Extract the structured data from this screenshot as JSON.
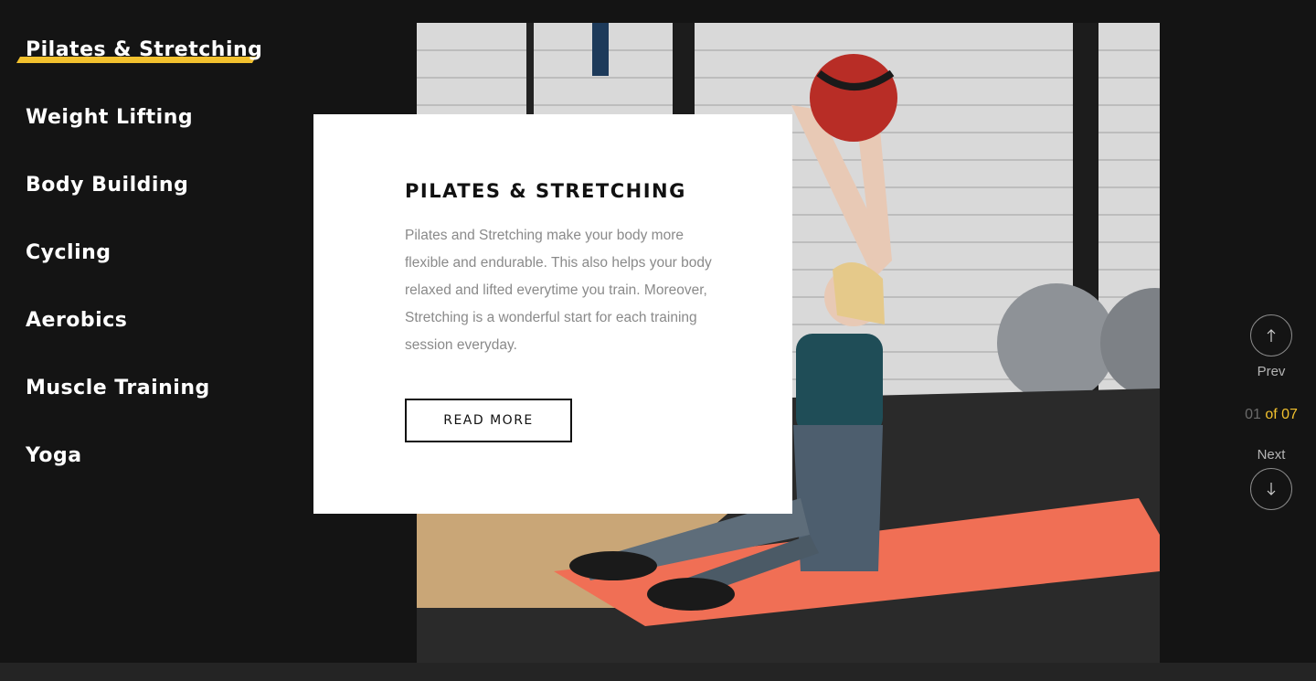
{
  "menu": {
    "items": [
      {
        "label": "Pilates & Stretching",
        "active": true
      },
      {
        "label": "Weight Lifting"
      },
      {
        "label": "Body Building"
      },
      {
        "label": "Cycling"
      },
      {
        "label": "Aerobics"
      },
      {
        "label": "Muscle Training"
      },
      {
        "label": "Yoga"
      }
    ]
  },
  "card": {
    "title": "PILATES & STRETCHING",
    "description": "Pilates and Stretching make your body more flexible and endurable. This also helps your body relaxed and lifted everytime you train. Moreover, Stretching is a wonderful start for each training session everyday.",
    "button_label": "READ MORE"
  },
  "pager": {
    "prev_label": "Prev",
    "next_label": "Next",
    "current": "01",
    "total_text": "of 07",
    "prev_icon": "arrow-up-icon",
    "next_icon": "arrow-down-icon"
  },
  "colors": {
    "background": "#141414",
    "accent": "#f2c12e",
    "card": "#ffffff"
  }
}
